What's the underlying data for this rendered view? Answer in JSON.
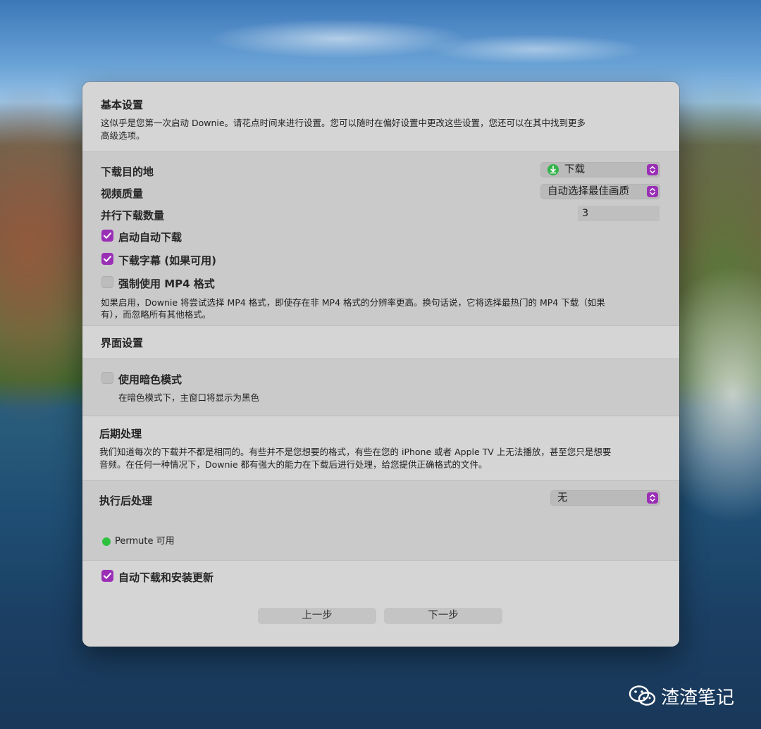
{
  "basic": {
    "title": "基本设置",
    "desc_line1": "这似乎是您第一次启动 Downie。请花点时间来进行设置。您可以随时在偏好设置中更改这些设置，您还可以在其中找到更多",
    "desc_line2": "高级选项。"
  },
  "download": {
    "dest_label": "下载目的地",
    "dest_value": "下载",
    "quality_label": "视频质量",
    "quality_value": "自动选择最佳画质",
    "parallel_label": "并行下载数量",
    "parallel_value": "3",
    "auto_download_label": "启动自动下载",
    "auto_download_checked": true,
    "subtitles_label": "下载字幕 (如果可用)",
    "subtitles_checked": true,
    "force_mp4_label": "强制使用 MP4 格式",
    "force_mp4_checked": false,
    "mp4_note_line1": "如果启用，Downie 将尝试选择 MP4 格式，即使存在非 MP4 格式的分辨率更高。换句话说，它将选择最热门的 MP4 下载（如果",
    "mp4_note_line2": "有），而忽略所有其他格式。"
  },
  "interface": {
    "title": "界面设置",
    "dark_mode_label": "使用暗色模式",
    "dark_mode_checked": false,
    "dark_mode_desc": "在暗色模式下，主窗口将显示为黑色"
  },
  "post": {
    "title": "后期处理",
    "desc_line1": "我们知道每次的下载并不都是相同的。有些并不是您想要的格式，有些在您的 iPhone 或者 Apple TV 上无法播放，甚至您只是想要",
    "desc_line2": "音频。在任何一种情况下，Downie 都有强大的能力在下载后进行处理，给您提供正确格式的文件。",
    "run_label": "执行后处理",
    "run_value": "无",
    "permute_status": "Permute 可用"
  },
  "updates": {
    "auto_update_label": "自动下载和安装更新",
    "auto_update_checked": true
  },
  "buttons": {
    "back": "上一步",
    "next": "下一步"
  },
  "watermark": {
    "text": "渣渣笔记"
  },
  "colors": {
    "accent": "#9a2fb6",
    "status_green": "#2ec13f",
    "dialog_bg": "#d6d5d6"
  }
}
